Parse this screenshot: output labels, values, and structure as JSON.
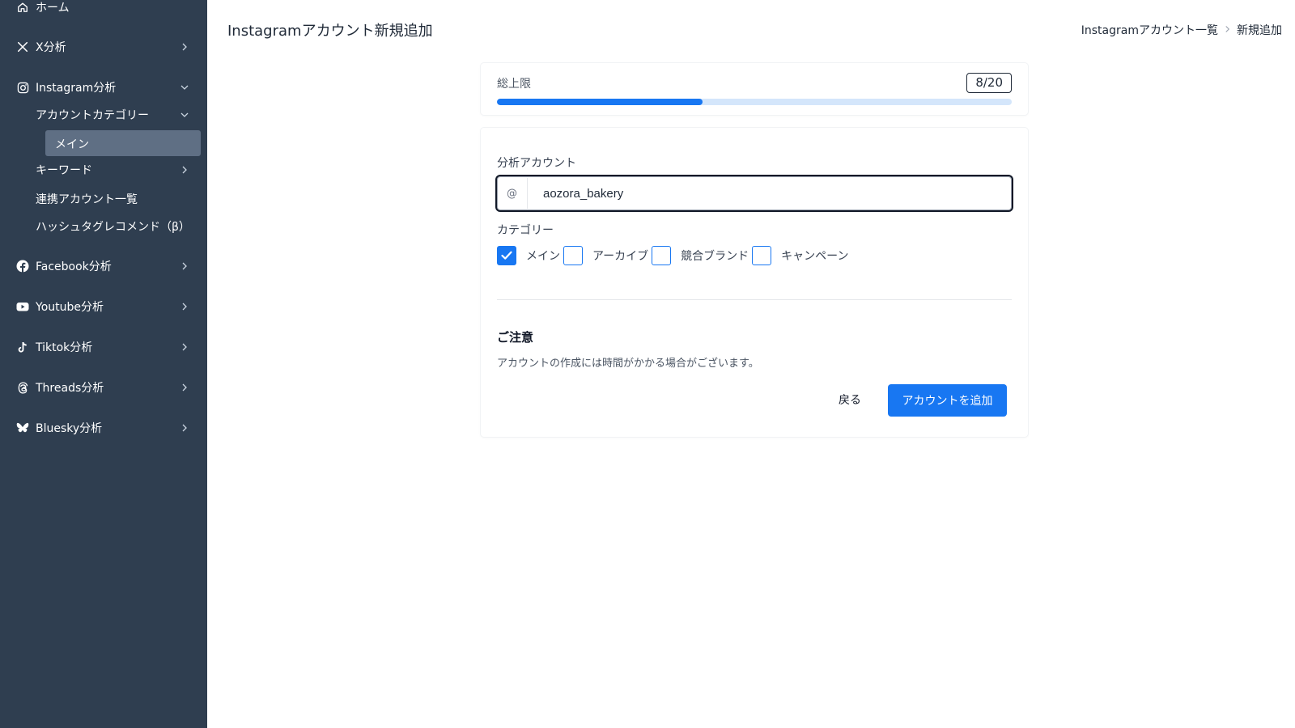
{
  "sidebar": {
    "items": [
      {
        "label": "ホーム",
        "icon": "home-icon"
      },
      {
        "label": "X分析",
        "icon": "x-logo-icon"
      },
      {
        "label": "Instagram分析",
        "icon": "instagram-icon"
      },
      {
        "label": "Facebook分析",
        "icon": "facebook-icon"
      },
      {
        "label": "Youtube分析",
        "icon": "youtube-icon"
      },
      {
        "label": "Tiktok分析",
        "icon": "tiktok-icon"
      },
      {
        "label": "Threads分析",
        "icon": "threads-icon"
      },
      {
        "label": "Bluesky分析",
        "icon": "bluesky-icon"
      }
    ],
    "instagram_sub": {
      "category": "アカウントカテゴリー",
      "category_active": "メイン",
      "keyword": "キーワード",
      "linked_accounts": "連携アカウント一覧",
      "hashtag": "ハッシュタグレコメンド（β）"
    }
  },
  "header": {
    "title": "Instagramアカウント新規追加",
    "breadcrumb": [
      "Instagramアカウント一覧",
      "新規追加"
    ]
  },
  "limit": {
    "label": "総上限",
    "badge": "8/20",
    "progress_percent": 40
  },
  "form": {
    "account_label": "分析アカウント",
    "account_prefix": "@",
    "account_value": "aozora_bakery",
    "category_label": "カテゴリー",
    "categories": [
      {
        "label": "メイン",
        "checked": true
      },
      {
        "label": "アーカイブ",
        "checked": false
      },
      {
        "label": "競合ブランド",
        "checked": false
      },
      {
        "label": "キャンペーン",
        "checked": false
      }
    ],
    "notice_title": "ご注意",
    "notice_text": "アカウントの作成には時間がかかる場合がございます。",
    "back_label": "戻る",
    "submit_label": "アカウントを追加"
  },
  "colors": {
    "sidebar_bg": "#2f3e50",
    "sidebar_active": "#5f6f84",
    "accent": "#1877f2",
    "progress_track": "#d4e6fb"
  }
}
